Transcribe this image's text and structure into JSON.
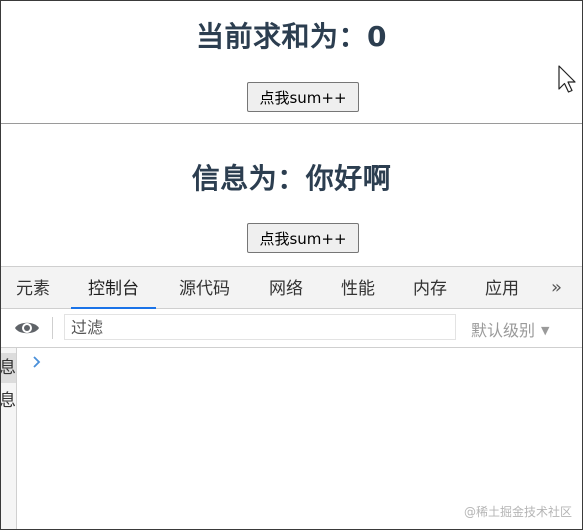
{
  "app": {
    "counter_heading": "当前求和为：0",
    "counter_button": "点我sum++",
    "message_heading": "信息为：你好啊",
    "message_button": "点我sum++"
  },
  "devtools": {
    "tabs": [
      "元素",
      "控制台",
      "源代码",
      "网络",
      "性能",
      "内存",
      "应用"
    ],
    "active_tab": "控制台",
    "more_tabs_glyph": "»",
    "filter_placeholder": "过滤",
    "levels_label": "默认级别",
    "sidebar_items": [
      "信息",
      "信息"
    ],
    "prompt_glyph": "›",
    "accent_color": "#1a73e8"
  },
  "watermark": "@稀土掘金技术社区"
}
